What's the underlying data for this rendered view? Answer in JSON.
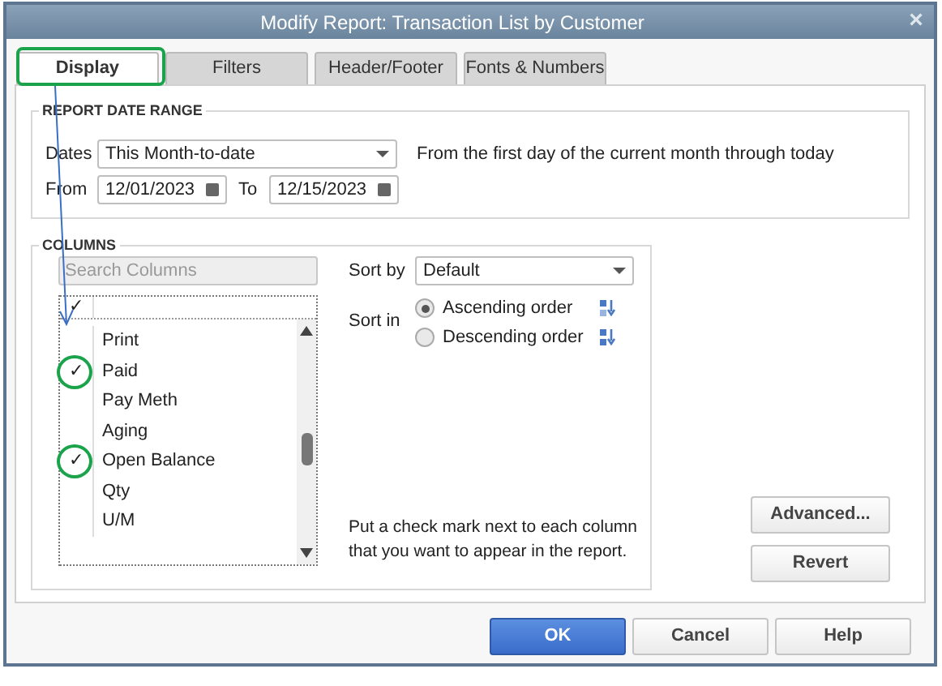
{
  "window": {
    "title": "Modify Report: Transaction List by Customer",
    "close": "×"
  },
  "tabs": [
    {
      "label": "Display",
      "selected": true
    },
    {
      "label": "Filters",
      "selected": false
    },
    {
      "label": "Header/Footer",
      "selected": false
    },
    {
      "label": "Fonts & Numbers",
      "selected": false
    }
  ],
  "report_date_range": {
    "heading": "REPORT DATE RANGE",
    "dates_label": "Dates",
    "dates_value": "This Month-to-date",
    "description": "From the first day of the current month through today",
    "from_label": "From",
    "from_value": "12/01/2023",
    "to_label": "To",
    "to_value": "12/15/2023"
  },
  "columns": {
    "heading": "COLUMNS",
    "search_placeholder": "Search Columns",
    "header_check": "✓",
    "check_glyph": "✓",
    "items": [
      {
        "label": "Print",
        "checked": false
      },
      {
        "label": "Paid",
        "checked": true
      },
      {
        "label": "Pay Meth",
        "checked": false
      },
      {
        "label": "Aging",
        "checked": false
      },
      {
        "label": "Open Balance",
        "checked": true
      },
      {
        "label": "Qty",
        "checked": false
      },
      {
        "label": "U/M",
        "checked": false
      }
    ],
    "sort_by_label": "Sort by",
    "sort_by_value": "Default",
    "sort_in_label": "Sort in",
    "orders": [
      {
        "label": "Ascending order",
        "selected": true,
        "kind": "ascending"
      },
      {
        "label": "Descending order",
        "selected": false,
        "kind": "descending"
      }
    ],
    "hint_lines": [
      "Put a check mark next to each column",
      "that you want to appear in the report."
    ]
  },
  "side_buttons": [
    "Advanced...",
    "Revert"
  ],
  "buttons": [
    {
      "label": "OK",
      "kind": "primary"
    },
    {
      "label": "Cancel",
      "kind": "normal"
    },
    {
      "label": "Help",
      "kind": "normal"
    }
  ]
}
